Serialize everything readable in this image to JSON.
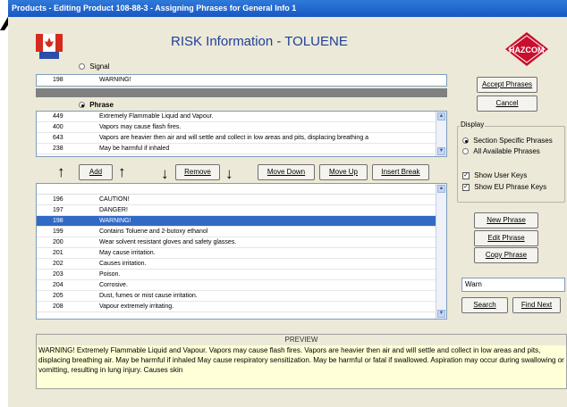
{
  "window": {
    "title": "Products - Editing Product 108-88-3 - Assigning Phrases for General Info 1"
  },
  "header": {
    "title": "RISK Information - TOLUENE",
    "logo_text": "HAZCOM"
  },
  "signal": {
    "label": "Signal",
    "selected": false,
    "code": "198",
    "text": "WARNING!"
  },
  "phrase": {
    "label": "Phrase",
    "selected": true,
    "rows": [
      {
        "code": "449",
        "text": "Extremely Flammable Liquid and Vapour."
      },
      {
        "code": "400",
        "text": "Vapors may cause flash fires."
      },
      {
        "code": "643",
        "text": "Vapors are heavier then air and will settle and collect in low areas and pits, displacing breathing a"
      },
      {
        "code": "238",
        "text": "May be harmful if inhaled"
      }
    ]
  },
  "toolbar": {
    "add": "Add",
    "remove": "Remove",
    "move_down": "Move Down",
    "move_up": "Move Up",
    "insert_break": "Insert Break"
  },
  "available": {
    "selected_code": "198",
    "rows": [
      {
        "code": "196",
        "text": "CAUTION!"
      },
      {
        "code": "197",
        "text": "DANGER!"
      },
      {
        "code": "198",
        "text": "WARNING!"
      },
      {
        "code": "199",
        "text": "Contains Toluene and 2-butoxy ethanol"
      },
      {
        "code": "200",
        "text": "Wear solvent resistant gloves and safety glasses."
      },
      {
        "code": "201",
        "text": "May cause irritation."
      },
      {
        "code": "202",
        "text": "Causes irritation."
      },
      {
        "code": "203",
        "text": "Poison."
      },
      {
        "code": "204",
        "text": "Corrosive."
      },
      {
        "code": "205",
        "text": "Dust, fumes or mist cause irritation."
      },
      {
        "code": "208",
        "text": "Vapour extremely irritating."
      }
    ]
  },
  "side": {
    "accept": "Accept Phrases",
    "cancel": "Cancel",
    "display_label": "Display",
    "opt_section": "Section Specific Phrases",
    "opt_all": "All Available Phrases",
    "selected_option": "section",
    "chk_user_keys": "Show User Keys",
    "chk_user_keys_checked": true,
    "chk_eu_keys": "Show EU Phrase Keys",
    "chk_eu_keys_checked": true,
    "new_phrase": "New Phrase",
    "edit_phrase": "Edit Phrase",
    "copy_phrase": "Copy Phrase",
    "search_value": "Warn",
    "search": "Search",
    "find_next": "Find Next"
  },
  "preview": {
    "title": "PREVIEW",
    "text": "WARNING! Extremely Flammable Liquid and Vapour. Vapors may cause flash fires. Vapors are heavier then air and will settle and collect in low areas and pits, displacing breathing air. May be harmful if inhaled May cause respiratory sensitization. May be harmful or fatal if swallowed. Aspiration may occur during swallowing or vomitting, resulting in lung injury. Causes skin"
  },
  "colors": {
    "titlebar": "#1f66d0",
    "heading": "#1e3f9a",
    "selection": "#316ac5",
    "preview_bg": "#ffffd8"
  }
}
